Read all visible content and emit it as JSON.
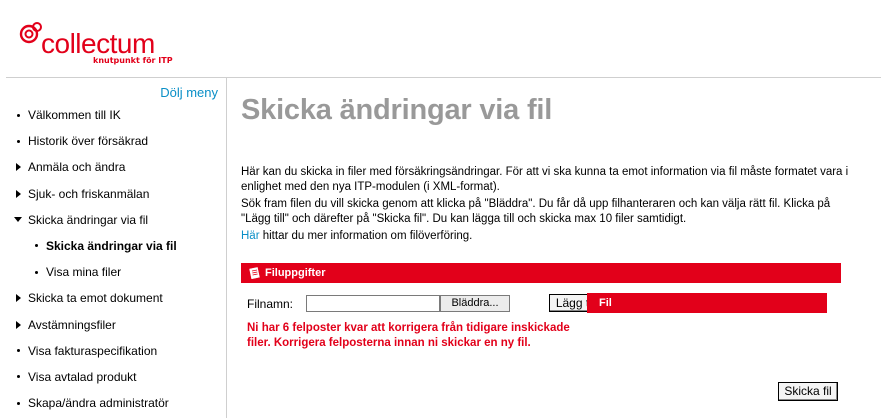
{
  "brand": {
    "name": "collectum",
    "tagline": "knutpunkt för ITP",
    "color": "#e2001a"
  },
  "sidebar": {
    "hide_menu": "Dölj meny",
    "items": [
      {
        "label": "Välkommen till IK",
        "marker": "dot",
        "level": 0,
        "active": false
      },
      {
        "label": "Historik över försäkrad",
        "marker": "dot",
        "level": 0,
        "active": false
      },
      {
        "label": "Anmäla och ändra",
        "marker": "triangle-right",
        "level": 0,
        "active": false
      },
      {
        "label": "Sjuk- och friskanmälan",
        "marker": "triangle-right",
        "level": 0,
        "active": false
      },
      {
        "label": "Skicka ändringar via fil",
        "marker": "triangle-down",
        "level": 0,
        "active": false
      },
      {
        "label": "Skicka ändringar via fil",
        "marker": "dot",
        "level": 1,
        "active": true
      },
      {
        "label": "Visa mina filer",
        "marker": "dot",
        "level": 1,
        "active": false
      },
      {
        "label": "Skicka ta emot dokument",
        "marker": "triangle-right",
        "level": 0,
        "active": false
      },
      {
        "label": "Avstämningsfiler",
        "marker": "triangle-right",
        "level": 0,
        "active": false
      },
      {
        "label": "Visa fakturaspecifikation",
        "marker": "dot",
        "level": 0,
        "active": false
      },
      {
        "label": "Visa avtalad produkt",
        "marker": "dot",
        "level": 0,
        "active": false
      },
      {
        "label": "Skapa/ändra administratör",
        "marker": "dot",
        "level": 0,
        "active": false
      }
    ]
  },
  "main": {
    "title": "Skicka ändringar via fil",
    "intro_1": "Här kan du skicka in filer med försäkringsändringar. För att vi ska kunna ta emot information via fil måste formatet vara i enlighet med den nya ITP-modulen (i XML-format).",
    "intro_2": "Sök fram filen du vill skicka genom att klicka på \"Bläddra\". Du får då upp filhanteraren och kan välja rätt fil. Klicka på \"Lägg till\" och därefter på \"Skicka fil\".  Du kan lägga till och skicka max 10 filer samtidigt.",
    "info_link": "Här",
    "info_rest": " hittar du mer information om filöverföring.",
    "section_title": "Filuppgifter",
    "file_label": "Filnamn:",
    "file_value": "",
    "browse_label": "Bläddra...",
    "add_label": "Lägg till",
    "file_panel_title": "Fil",
    "error_text": "Ni har 6 felposter kvar att korrigera från tidigare inskickade filer. Korrigera felposterna innan ni skickar en ny fil.",
    "send_label": "Skicka fil"
  }
}
